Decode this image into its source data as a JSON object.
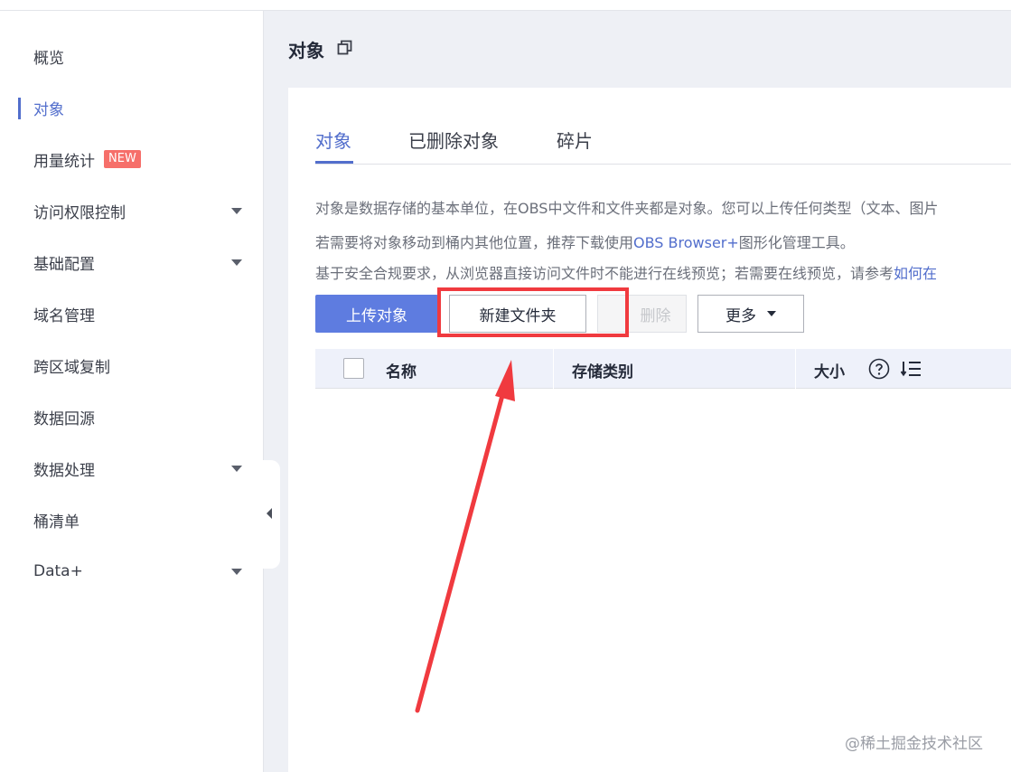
{
  "sidebar": {
    "items": [
      {
        "label": "概览",
        "active": false,
        "has_caret": false
      },
      {
        "label": "对象",
        "active": true,
        "has_caret": false
      },
      {
        "label": "用量统计",
        "active": false,
        "has_caret": false,
        "badge": "NEW"
      },
      {
        "label": "访问权限控制",
        "active": false,
        "has_caret": true
      },
      {
        "label": "基础配置",
        "active": false,
        "has_caret": true
      },
      {
        "label": "域名管理",
        "active": false,
        "has_caret": false
      },
      {
        "label": "跨区域复制",
        "active": false,
        "has_caret": false
      },
      {
        "label": "数据回源",
        "active": false,
        "has_caret": false
      },
      {
        "label": "数据处理",
        "active": false,
        "has_caret": true
      },
      {
        "label": "桶清单",
        "active": false,
        "has_caret": false
      },
      {
        "label": "Data+",
        "active": false,
        "has_caret": true
      }
    ]
  },
  "header": {
    "title": "对象",
    "icon": "copy-icon"
  },
  "tabs": [
    {
      "label": "对象",
      "active": true
    },
    {
      "label": "已删除对象",
      "active": false
    },
    {
      "label": "碎片",
      "active": false
    }
  ],
  "description": {
    "line1": "对象是数据存储的基本单位，在OBS中文件和文件夹都是对象。您可以上传任何类型（文本、图片",
    "line2_prefix": "若需要将对象移动到桶内其他位置，推荐下载使用",
    "line2_link": "OBS Browser+",
    "line2_suffix": "图形化管理工具。",
    "line3_prefix": "基于安全合规要求，从浏览器直接访问文件时不能进行在线预览；若需要在线预览，请参考",
    "line3_link": "如何在"
  },
  "toolbar": {
    "upload_label": "上传对象",
    "new_folder_label": "新建文件夹",
    "delete_label": "删除",
    "more_label": "更多"
  },
  "table": {
    "columns": [
      "名称",
      "存储类别",
      "大小"
    ]
  },
  "watermark": "@稀土掘金技术社区",
  "colors": {
    "accent": "#526ecc",
    "primary_button": "#5e7ce0",
    "highlight": "#f03a3f",
    "badge": "#f66f6a"
  }
}
